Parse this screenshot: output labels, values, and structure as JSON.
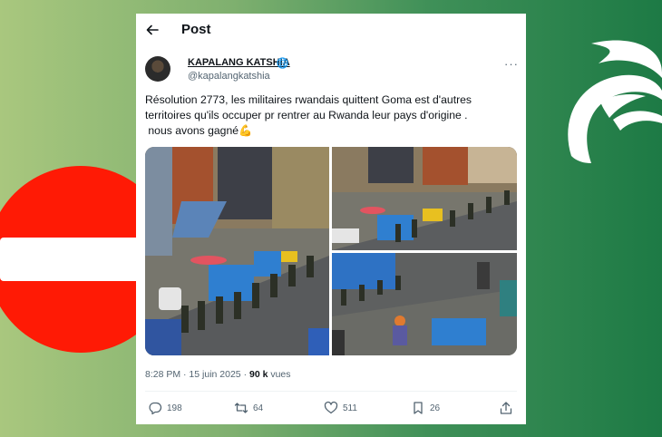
{
  "header": {
    "title": "Post"
  },
  "user": {
    "name": "KAPALANG KATSHIA",
    "handle": "@kapalangkatshia"
  },
  "post": {
    "lines": [
      "Résolution 2773, les militaires rwandais quittent Goma est d'autres",
      "territoires qu'ils occuper pr rentrer au Rwanda leur pays d'origine .",
      " nous avons gagné💪"
    ]
  },
  "meta": {
    "time_date": "8:28 PM · 15 juin 2025 · ",
    "views_count": "90 k",
    "views_label": " vues"
  },
  "actions": {
    "replies": "198",
    "reposts": "64",
    "likes": "511",
    "bookmarks": "26"
  },
  "colors": {
    "no_entry_red": "#ff1a05",
    "bg_green_dark": "#1d7a45",
    "bg_green_light": "#a9c77e"
  }
}
